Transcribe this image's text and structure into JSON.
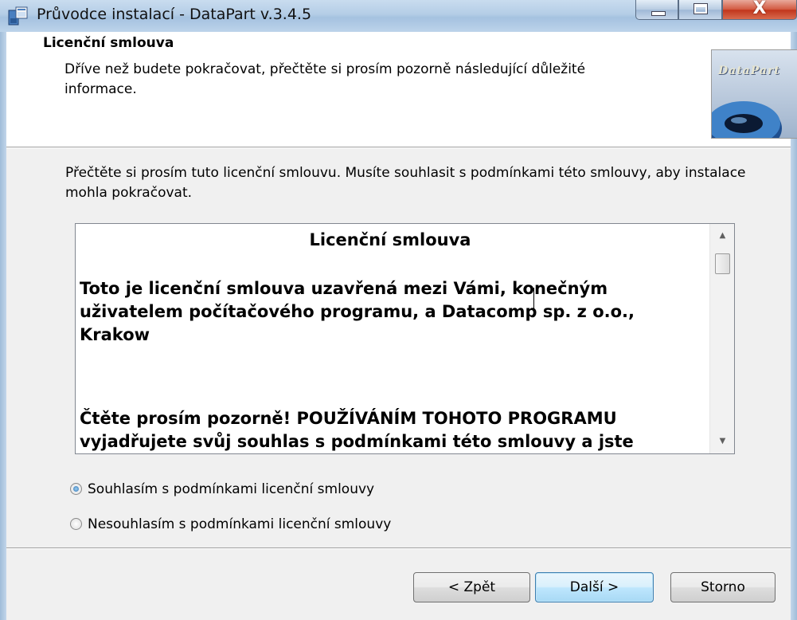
{
  "window": {
    "title": "Průvodce instalací - DataPart v.3.4.5",
    "close_label": "X"
  },
  "header": {
    "title": "Licenční smlouva",
    "description": "Dříve než budete pokračovat, přečtěte si prosím pozorně následující důležité informace.",
    "logo_text": "DataPart"
  },
  "body": {
    "intro": "Přečtěte si prosím tuto licenční smlouvu. Musíte souhlasit s podmínkami této smlouvy, aby instalace mohla pokračovat.",
    "license": {
      "heading": "Licenční smlouva",
      "paragraph1": "Toto je licenční smlouva uzavřená  mezi Vámi, konečným uživatelem počítačového programu, a Datacomp sp. z o.o., Krakow",
      "paragraph2": "Čtěte prosím pozorně! POUŽÍVÁNÍM TOHOTO PROGRAMU vyjadřujete svůj souhlas s podmínkami této smlouvy a jste"
    },
    "options": {
      "accept": "Souhlasím s podmínkami licenční smlouvy",
      "decline": "Nesouhlasím s podmínkami licenční smlouvy",
      "selected": "accept"
    }
  },
  "buttons": {
    "back": "< Zpět",
    "next": "Další >",
    "cancel": "Storno"
  }
}
